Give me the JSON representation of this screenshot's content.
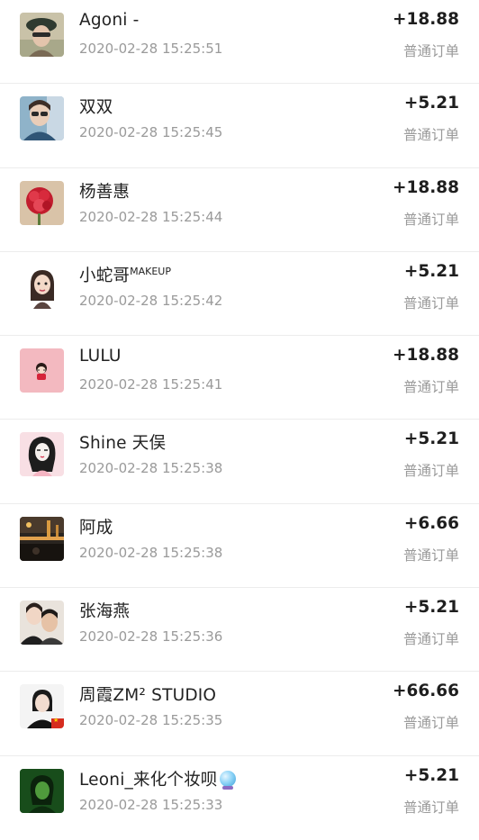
{
  "orders": [
    {
      "name": "Agoni -",
      "time": "2020-02-28 15:25:51",
      "amount": "+18.88",
      "type": "普通订单",
      "avatar": "avatar-woman-hat"
    },
    {
      "name": "双双",
      "time": "2020-02-28 15:25:45",
      "amount": "+5.21",
      "type": "普通订单",
      "avatar": "avatar-woman-car"
    },
    {
      "name": "杨善惠",
      "time": "2020-02-28 15:25:44",
      "amount": "+18.88",
      "type": "普通订单",
      "avatar": "avatar-red-flowers"
    },
    {
      "name": "小蛇哥",
      "name_sup": "MAKEUP",
      "time": "2020-02-28 15:25:42",
      "amount": "+5.21",
      "type": "普通订单",
      "avatar": "avatar-cartoon-girl"
    },
    {
      "name": "LULU",
      "time": "2020-02-28 15:25:41",
      "amount": "+18.88",
      "type": "普通订单",
      "avatar": "avatar-pink-character"
    },
    {
      "name": "Shine 天俣",
      "time": "2020-02-28 15:25:38",
      "amount": "+5.21",
      "type": "普通订单",
      "avatar": "avatar-sketch-girl"
    },
    {
      "name": "阿成",
      "time": "2020-02-28 15:25:38",
      "amount": "+6.66",
      "type": "普通订单",
      "avatar": "avatar-night-city"
    },
    {
      "name": "张海燕",
      "time": "2020-02-28 15:25:36",
      "amount": "+5.21",
      "type": "普通订单",
      "avatar": "avatar-couple"
    },
    {
      "name": "周霞ZM² STUDIO",
      "time": "2020-02-28 15:25:35",
      "amount": "+66.66",
      "type": "普通订单",
      "avatar": "avatar-woman-flag"
    },
    {
      "name": "Leoni_来化个妆呗",
      "time": "2020-02-28 15:25:33",
      "amount": "+5.21",
      "type": "普通订单",
      "avatar": "avatar-green-portrait",
      "emoji": "crystal-ball-icon"
    }
  ]
}
